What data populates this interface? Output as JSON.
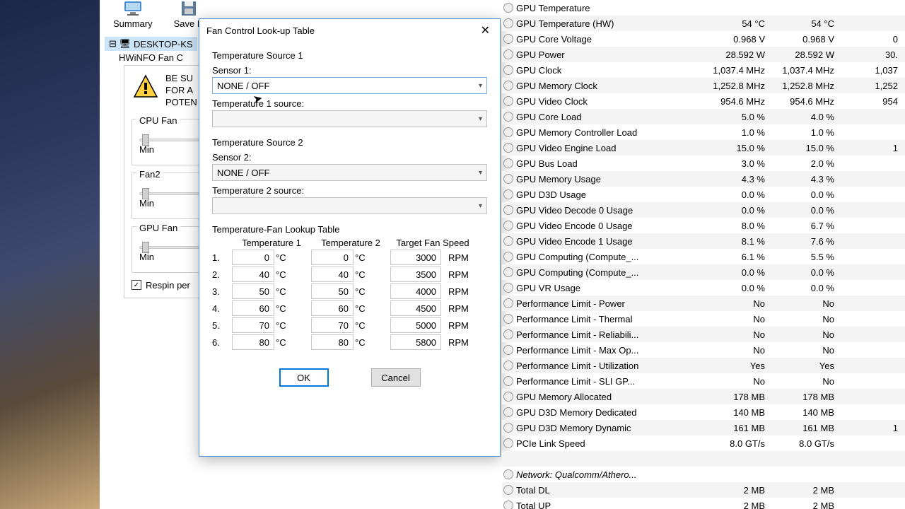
{
  "toolbar": {
    "summary": "Summary",
    "save": "Save R"
  },
  "tree": {
    "node": "DESKTOP-KS",
    "sub": "HWiNFO Fan C"
  },
  "fan_panel": {
    "warn1": "BE SU",
    "warn2": "FOR A",
    "warn3": "POTEN",
    "cpu": "CPU Fan",
    "fan2": "Fan2",
    "gpu": "GPU Fan",
    "min": "Min",
    "respin": "Respin per"
  },
  "dialog": {
    "title": "Fan Control Look-up Table",
    "src1": "Temperature Source 1",
    "sensor1": "Sensor 1:",
    "none": "NONE / OFF",
    "t1src": "Temperature 1 source:",
    "src2": "Temperature Source 2",
    "sensor2": "Sensor 2:",
    "t2src": "Temperature 2 source:",
    "lookup": "Temperature-Fan Lookup Table",
    "col_t1": "Temperature 1",
    "col_t2": "Temperature 2",
    "col_fan": "Target Fan Speed",
    "rows": [
      {
        "n": "1.",
        "t1": "0",
        "t2": "0",
        "fan": "3000"
      },
      {
        "n": "2.",
        "t1": "40",
        "t2": "40",
        "fan": "3500"
      },
      {
        "n": "3.",
        "t1": "50",
        "t2": "50",
        "fan": "4000"
      },
      {
        "n": "4.",
        "t1": "60",
        "t2": "60",
        "fan": "4500"
      },
      {
        "n": "5.",
        "t1": "70",
        "t2": "70",
        "fan": "5000"
      },
      {
        "n": "6.",
        "t1": "80",
        "t2": "80",
        "fan": "5800"
      }
    ],
    "degc": "°C",
    "rpm": "RPM",
    "ok": "OK",
    "cancel": "Cancel"
  },
  "sensors": [
    {
      "name": "GPU Temperature",
      "v1": "",
      "v2": "",
      "v3": ""
    },
    {
      "name": "GPU Temperature (HW)",
      "v1": "54 °C",
      "v2": "54 °C",
      "v3": ""
    },
    {
      "name": "GPU Core Voltage",
      "v1": "0.968 V",
      "v2": "0.968 V",
      "v3": "0"
    },
    {
      "name": "GPU Power",
      "v1": "28.592 W",
      "v2": "28.592 W",
      "v3": "30."
    },
    {
      "name": "GPU Clock",
      "v1": "1,037.4 MHz",
      "v2": "1,037.4 MHz",
      "v3": "1,037"
    },
    {
      "name": "GPU Memory Clock",
      "v1": "1,252.8 MHz",
      "v2": "1,252.8 MHz",
      "v3": "1,252"
    },
    {
      "name": "GPU Video Clock",
      "v1": "954.6 MHz",
      "v2": "954.6 MHz",
      "v3": "954"
    },
    {
      "name": "GPU Core Load",
      "v1": "5.0 %",
      "v2": "4.0 %",
      "v3": ""
    },
    {
      "name": "GPU Memory Controller Load",
      "v1": "1.0 %",
      "v2": "1.0 %",
      "v3": ""
    },
    {
      "name": "GPU Video Engine Load",
      "v1": "15.0 %",
      "v2": "15.0 %",
      "v3": "1"
    },
    {
      "name": "GPU Bus Load",
      "v1": "3.0 %",
      "v2": "2.0 %",
      "v3": ""
    },
    {
      "name": "GPU Memory Usage",
      "v1": "4.3 %",
      "v2": "4.3 %",
      "v3": ""
    },
    {
      "name": "GPU D3D Usage",
      "v1": "0.0 %",
      "v2": "0.0 %",
      "v3": ""
    },
    {
      "name": "GPU Video Decode 0 Usage",
      "v1": "0.0 %",
      "v2": "0.0 %",
      "v3": ""
    },
    {
      "name": "GPU Video Encode 0 Usage",
      "v1": "8.0 %",
      "v2": "6.7 %",
      "v3": ""
    },
    {
      "name": "GPU Video Encode 1 Usage",
      "v1": "8.1 %",
      "v2": "7.6 %",
      "v3": ""
    },
    {
      "name": "GPU Computing (Compute_...",
      "v1": "6.1 %",
      "v2": "5.5 %",
      "v3": ""
    },
    {
      "name": "GPU Computing (Compute_...",
      "v1": "0.0 %",
      "v2": "0.0 %",
      "v3": ""
    },
    {
      "name": "GPU VR Usage",
      "v1": "0.0 %",
      "v2": "0.0 %",
      "v3": ""
    },
    {
      "name": "Performance Limit - Power",
      "v1": "No",
      "v2": "No",
      "v3": ""
    },
    {
      "name": "Performance Limit - Thermal",
      "v1": "No",
      "v2": "No",
      "v3": ""
    },
    {
      "name": "Performance Limit - Reliabili...",
      "v1": "No",
      "v2": "No",
      "v3": ""
    },
    {
      "name": "Performance Limit - Max Op...",
      "v1": "No",
      "v2": "No",
      "v3": ""
    },
    {
      "name": "Performance Limit - Utilization",
      "v1": "Yes",
      "v2": "Yes",
      "v3": ""
    },
    {
      "name": "Performance Limit - SLI GP...",
      "v1": "No",
      "v2": "No",
      "v3": ""
    },
    {
      "name": "GPU Memory Allocated",
      "v1": "178 MB",
      "v2": "178 MB",
      "v3": ""
    },
    {
      "name": "GPU D3D Memory Dedicated",
      "v1": "140 MB",
      "v2": "140 MB",
      "v3": ""
    },
    {
      "name": "GPU D3D Memory Dynamic",
      "v1": "161 MB",
      "v2": "161 MB",
      "v3": "1"
    },
    {
      "name": "PCIe Link Speed",
      "v1": "8.0 GT/s",
      "v2": "8.0 GT/s",
      "v3": ""
    },
    {
      "name": "",
      "v1": "",
      "v2": "",
      "v3": "",
      "blank": true
    },
    {
      "name": "Network: Qualcomm/Athero...",
      "v1": "",
      "v2": "",
      "v3": "",
      "italic": true,
      "net": true
    },
    {
      "name": "Total DL",
      "v1": "2 MB",
      "v2": "2 MB",
      "v3": ""
    },
    {
      "name": "Total UP",
      "v1": "2 MB",
      "v2": "2 MB",
      "v3": ""
    }
  ]
}
